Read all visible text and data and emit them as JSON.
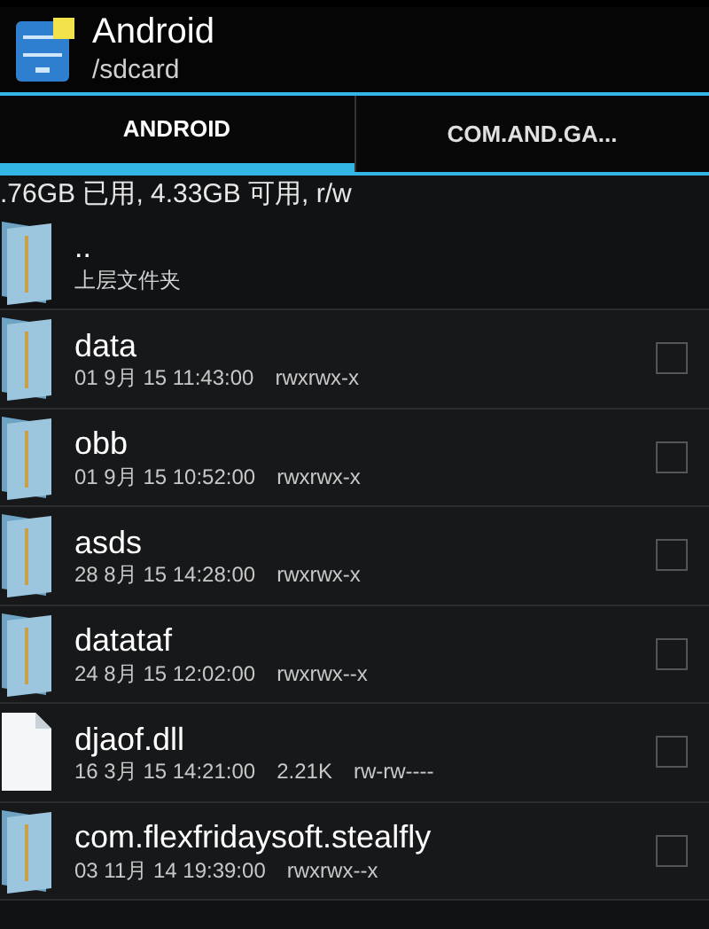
{
  "header": {
    "title": "Android",
    "path": "/sdcard"
  },
  "tabs": [
    {
      "label": "ANDROID",
      "selected": true
    },
    {
      "label": "COM.AND.GA...",
      "selected": false
    }
  ],
  "storage": ".76GB 已用, 4.33GB 可用, r/w",
  "parent": {
    "name": "..",
    "label": "上层文件夹"
  },
  "files": [
    {
      "kind": "folder",
      "name": "data",
      "date": "01 9月 15 11:43:00",
      "perms": "rwxrwx-x",
      "checked": false
    },
    {
      "kind": "folder",
      "name": "obb",
      "date": "01 9月 15 10:52:00",
      "perms": "rwxrwx-x",
      "checked": false
    },
    {
      "kind": "folder",
      "name": "asds",
      "date": "28 8月 15 14:28:00",
      "perms": "rwxrwx-x",
      "checked": false
    },
    {
      "kind": "folder",
      "name": "datataf",
      "date": "24 8月 15 12:02:00",
      "perms": "rwxrwx--x",
      "checked": false
    },
    {
      "kind": "file",
      "name": "djaof.dll",
      "date": "16 3月 15 14:21:00",
      "size": "2.21K",
      "perms": "rw-rw----",
      "checked": false
    },
    {
      "kind": "folder",
      "name": "com.flexfridaysoft.stealfly",
      "date": "03 11月 14 19:39:00",
      "perms": "rwxrwx--x",
      "checked": false
    }
  ]
}
